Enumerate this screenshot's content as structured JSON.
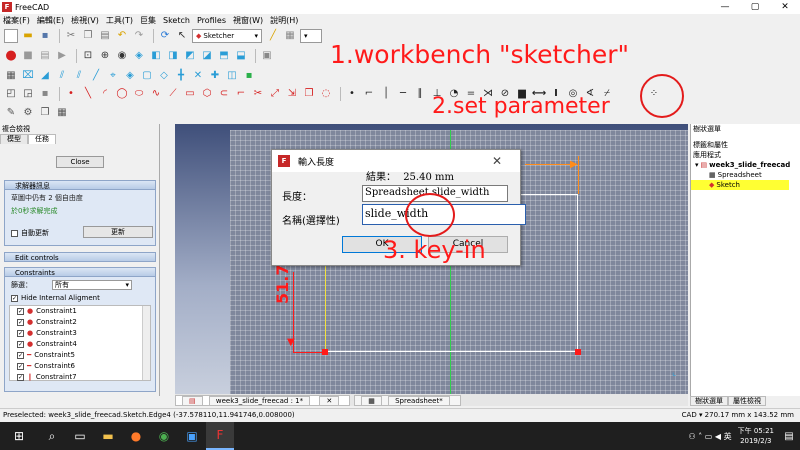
{
  "window": {
    "title": "FreeCAD",
    "buttons": [
      "—",
      "▢",
      "✕"
    ]
  },
  "menu": [
    "檔案(F)",
    "編輯(E)",
    "檢視(V)",
    "工具(T)",
    "巨集",
    "Sketch",
    "Profiles",
    "視窗(W)",
    "說明(H)"
  ],
  "toolbar": {
    "workbench_value": "Sketcher",
    "row1_icons": [
      "new-file",
      "open",
      "save",
      "print",
      "cut",
      "copy",
      "paste",
      "undo",
      "redo",
      "refresh",
      "pointer",
      "help"
    ],
    "row2_icons": [
      "record",
      "stop",
      "macro",
      "play",
      "zoom-fit",
      "zoom-select",
      "draw-style",
      "view-iso",
      "view-front",
      "view-top",
      "view-right",
      "view-rear",
      "view-bottom",
      "view-left",
      "measure",
      "part"
    ],
    "row3_icons": [
      "grid",
      "lock",
      "snap",
      "sketch-a",
      "sketch-b",
      "sketch-c",
      "sketch-d",
      "sketch-e",
      "sketch-f",
      "sketch-g",
      "sketch-h",
      "sketch-i",
      "sketch-j",
      "sketch-k",
      "sketch-l"
    ],
    "row4_icons": [
      "point",
      "line",
      "arc",
      "circle",
      "conic",
      "bspline",
      "polyline",
      "rectangle",
      "polygon",
      "slot",
      "fillet",
      "trim",
      "extend",
      "external",
      "carbon",
      "construction"
    ],
    "constraint_icons": [
      "coincident",
      "point-on",
      "vertical",
      "horizontal",
      "parallel",
      "perpendicular",
      "tangent",
      "equal",
      "symmetric",
      "block",
      "lock",
      "horizontal-distance",
      "vertical-distance",
      "radius",
      "angle",
      "snell"
    ]
  },
  "annotations": {
    "step1": "1.workbench \"sketcher\"",
    "step2": "2.set parameter",
    "step3": "3. key-in"
  },
  "left_panel": {
    "title": "複合檢視",
    "tabs": [
      "模型",
      "任務"
    ],
    "close_label": "Close",
    "solver": {
      "header": "求解器訊息",
      "line1": "草圖中仍有 2 個自由度",
      "line2": "於0秒求解完成",
      "auto_update_label": "自動更新",
      "update_button": "更新"
    },
    "edit_controls": {
      "header": "Edit controls"
    },
    "constraints": {
      "header": "Constraints",
      "filter_label": "篩選：",
      "filter_value": "所有",
      "hide_internal_label": "Hide Internal Aligment",
      "items": [
        "Constraint1",
        "Constraint2",
        "Constraint3",
        "Constraint4",
        "Constraint5",
        "Constraint6",
        "Constraint7"
      ]
    }
  },
  "viewport": {
    "dim_label_vertical": "51.71"
  },
  "dialog": {
    "title": "輸入長度",
    "result_label": "結果：",
    "result_value": "25.40 mm",
    "length_label": "長度：",
    "length_value": "Spreadsheet.slide_width",
    "autocomplete_value": "slide_width",
    "name_label": "名稱(選擇性)",
    "ok_label": "OK",
    "cancel_label": "Cancel",
    "close_symbol": "✕"
  },
  "right_panel": {
    "title": "樹狀選單",
    "section_labels": "標籤和屬性",
    "section_app": "應用程式",
    "doc_name": "week3_slide_freecad",
    "items": [
      "Spreadsheet",
      "Sketch"
    ],
    "tabs": [
      "樹狀選單",
      "屬性檢視"
    ]
  },
  "doc_tabs": [
    "week3_slide_freecad : 1*",
    "Spreadsheet*"
  ],
  "status": {
    "left": "Preselected: week3_slide_freecad.Sketch.Edge4 (-37.578110,11.941746,0.008000)",
    "right": "CAD ▾   270.17 mm x 143.52 mm"
  },
  "taskbar": {
    "time": "下午 05:21",
    "date": "2019/2/3",
    "lang": "英"
  },
  "colors": {
    "accent_red": "#e31b1b",
    "selection_yellow": "#ffff33"
  }
}
